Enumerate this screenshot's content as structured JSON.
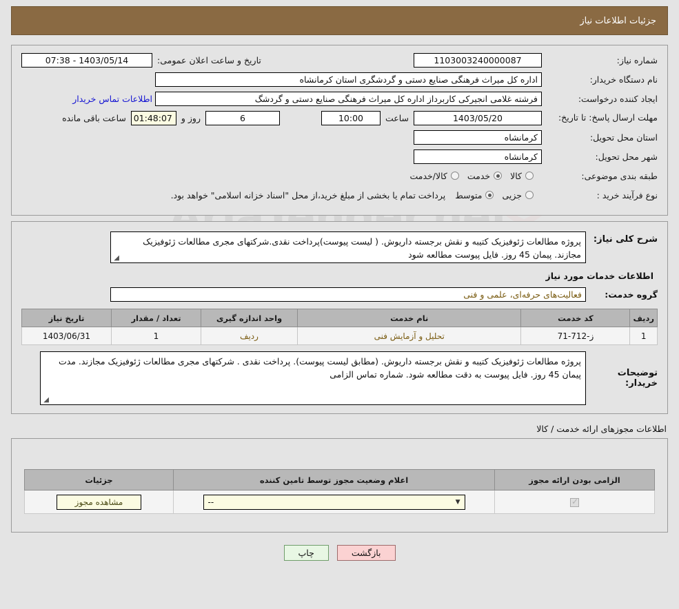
{
  "header": {
    "title": "جزئیات اطلاعات نیاز"
  },
  "form": {
    "need_number_label": "شماره نیاز:",
    "need_number_value": "1103003240000087",
    "announce_label": "تاریخ و ساعت اعلان عمومی:",
    "announce_value": "1403/05/14 - 07:38",
    "buyer_org_label": "نام دستگاه خریدار:",
    "buyer_org_value": "اداره کل میراث فرهنگی  صنایع دستی و گردشگری استان کرمانشاه",
    "creator_label": "ایجاد کننده درخواست:",
    "creator_value": "فرشته غلامی انجیرکی کاربرداز اداره کل میراث فرهنگی  صنایع دستی و گردشگ",
    "contact_link": "اطلاعات تماس خریدار",
    "deadline_label": "مهلت ارسال پاسخ: تا تاریخ:",
    "deadline_date": "1403/05/20",
    "hour_label": "ساعت",
    "hour_value": "10:00",
    "days_value": "6",
    "days_label": "روز و",
    "countdown_value": "01:48:07",
    "countdown_label": "ساعت باقی مانده",
    "province_label": "استان محل تحویل:",
    "province_value": "کرمانشاه",
    "city_label": "شهر محل تحویل:",
    "city_value": "کرمانشاه",
    "category_label": "طبقه بندی موضوعی:",
    "category_options": [
      {
        "label": "کالا",
        "selected": false
      },
      {
        "label": "خدمت",
        "selected": true
      },
      {
        "label": "کالا/خدمت",
        "selected": false
      }
    ],
    "process_label": "نوع فرآیند خرید :",
    "process_options": [
      {
        "label": "جزیی",
        "selected": false
      },
      {
        "label": "متوسط",
        "selected": true
      }
    ],
    "payment_note": "پرداخت تمام یا بخشی از مبلغ خرید،از محل \"اسناد خزانه اسلامی\" خواهد بود."
  },
  "description": {
    "label": "شرح کلی نیاز:",
    "value": "پروژه مطالعات ژئوفیزیک کتیبه و نقش برجسته داریوش. ( لیست پیوست)پرداخت نقدی.شرکتهای مجری مطالعات ژئوفیزیک مجازند. پیمان 45 روز. فایل پیوست مطالعه شود"
  },
  "service_section": {
    "title": "اطلاعات خدمات مورد نیاز",
    "group_label": "گروه خدمت:",
    "group_value": "فعالیت‌های حرفه‌ای، علمی و فنی"
  },
  "service_table": {
    "columns": [
      "ردیف",
      "کد خدمت",
      "نام خدمت",
      "واحد اندازه گیری",
      "تعداد / مقدار",
      "تاریخ نیاز"
    ],
    "rows": [
      {
        "index": "1",
        "code": "ز-712-71",
        "name": "تحلیل و آزمایش فنی",
        "unit": "ردیف",
        "quantity": "1",
        "date": "1403/06/31"
      }
    ]
  },
  "buyer_notes": {
    "label": "توضیحات خریدار:",
    "value": "پروژه مطالعات ژئوفیزیک کتیبه و نقش برجسته داریوش. (مطابق لیست پیوست). پرداخت نقدی . شرکتهای مجری مطالعات ژئوفیزیک مجازند. مدت پیمان 45 روز. فایل پیوست به دقت مطالعه شود. شماره تماس الزامی"
  },
  "permit_section": {
    "title": "اطلاعات مجوزهای ارائه خدمت / کالا",
    "columns": [
      "الزامی بودن ارائه مجوز",
      "اعلام وضعیت مجوز توسط تامین کننده",
      "جزئیات"
    ],
    "row": {
      "required_checked": true,
      "status_value": "--",
      "details_button": "مشاهده مجوز"
    }
  },
  "footer": {
    "back_label": "بازگشت",
    "print_label": "چاپ"
  },
  "watermark": {
    "text": "AriaTender.net"
  },
  "colors": {
    "header_bg": "#8a6a43",
    "link": "#1414d2",
    "table_text": "#7a5c12",
    "back_button": "#fbd2d2",
    "print_button": "#e8f7e4",
    "field_yellow": "#fbfbe2"
  }
}
